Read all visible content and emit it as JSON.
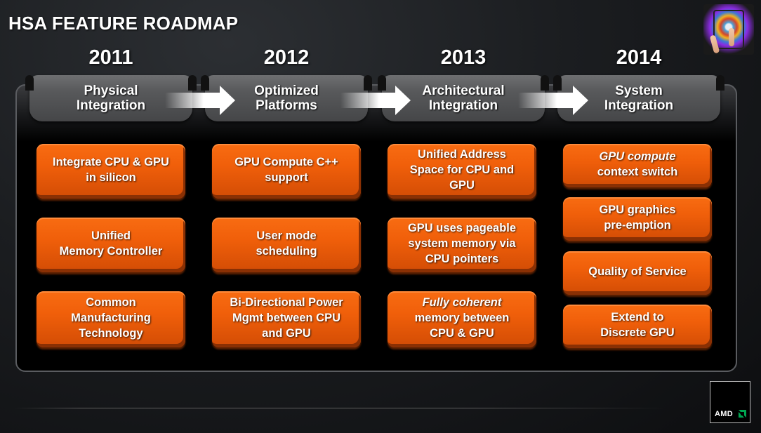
{
  "title": "HSA FEATURE ROADMAP",
  "colors": {
    "box_orange": "#f05f0a",
    "tab_gray": "#58595b",
    "amd_green": "#00a651",
    "background": "#1b1d20"
  },
  "phases": [
    {
      "year": "2011",
      "stage_line1": "Physical",
      "stage_line2": "Integration",
      "features": [
        {
          "line1": "Integrate CPU & GPU",
          "line2": "in silicon"
        },
        {
          "line1": "Unified",
          "line2": "Memory Controller"
        },
        {
          "line1": "Common",
          "line2": "Manufacturing",
          "line3": "Technology"
        }
      ]
    },
    {
      "year": "2012",
      "stage_line1": "Optimized",
      "stage_line2": "Platforms",
      "features": [
        {
          "line1": "GPU Compute C++",
          "line2": "support"
        },
        {
          "line1": "User mode",
          "line2": "scheduling"
        },
        {
          "line1": "Bi-Directional Power",
          "line2": "Mgmt between CPU",
          "line3": "and GPU"
        }
      ]
    },
    {
      "year": "2013",
      "stage_line1": "Architectural",
      "stage_line2": "Integration",
      "features": [
        {
          "line1": "Unified Address",
          "line2": "Space for CPU and",
          "line3": "GPU"
        },
        {
          "line1": "GPU uses pageable",
          "line2": "system memory via",
          "line3": "CPU pointers"
        },
        {
          "line1_italic": "Fully coherent",
          "line2": "memory between",
          "line3": "CPU & GPU"
        }
      ]
    },
    {
      "year": "2014",
      "stage_line1": "System",
      "stage_line2": "Integration",
      "features": [
        {
          "line1_italic": "GPU compute",
          "line2": "context switch"
        },
        {
          "line1": "GPU graphics",
          "line2": "pre-emption"
        },
        {
          "line1": "Quality of Service"
        },
        {
          "line1": "Extend to",
          "line2": "Discrete GPU"
        }
      ]
    }
  ],
  "icons": {
    "arrow": "arrow-right-icon",
    "hero": "tablet-touch-image",
    "logo": "amd-logo"
  },
  "logo": {
    "text": "AMD"
  }
}
